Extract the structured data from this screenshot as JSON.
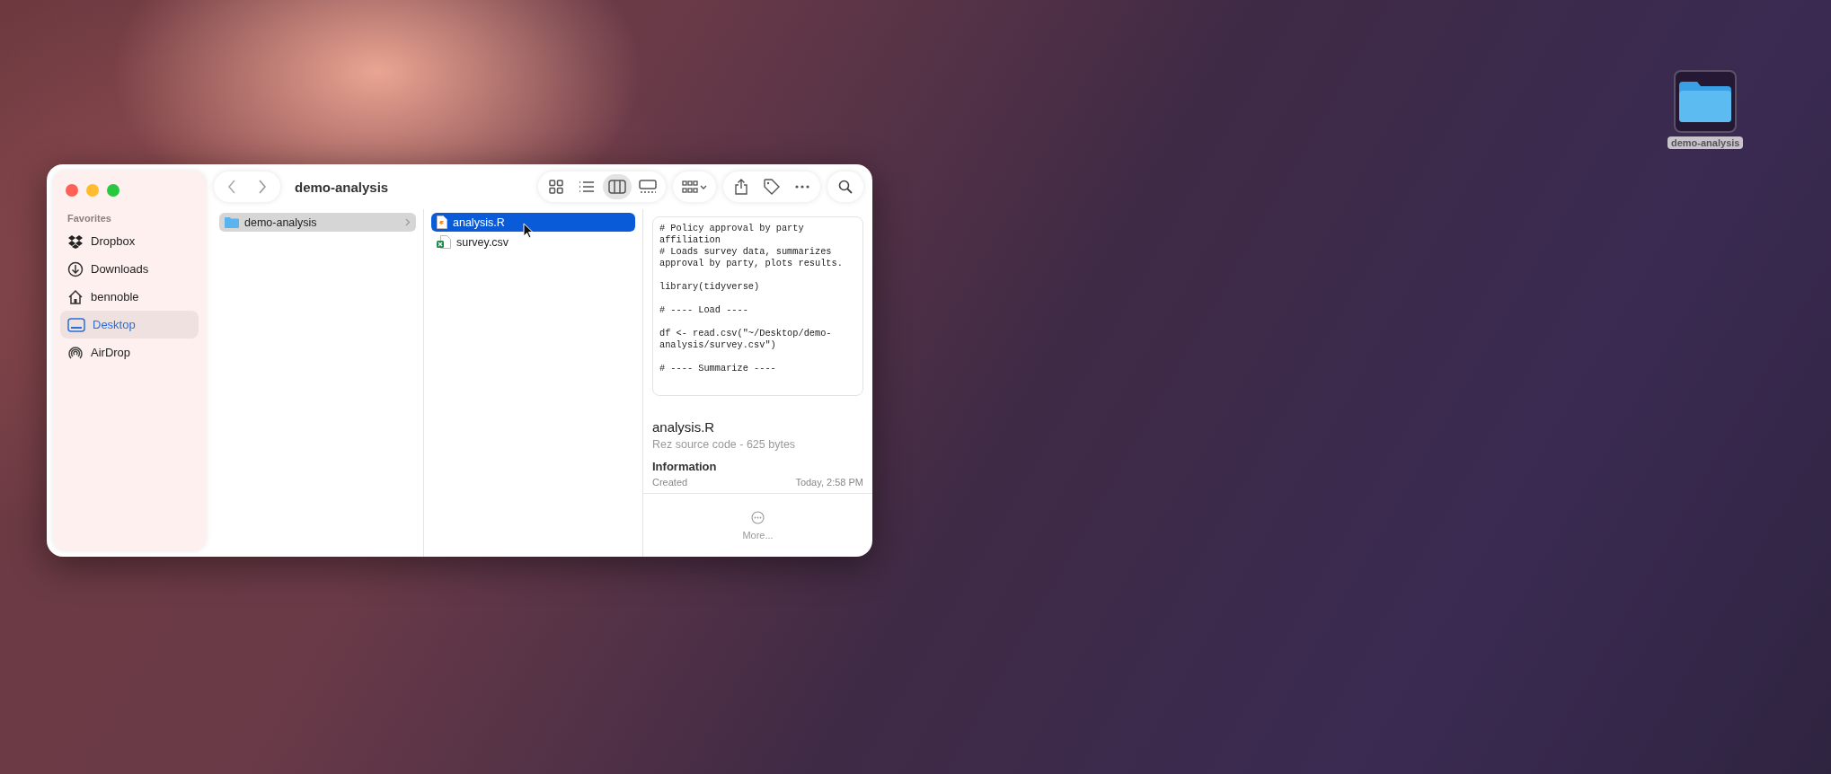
{
  "window": {
    "title": "demo-analysis"
  },
  "sidebar": {
    "heading": "Favorites",
    "items": [
      {
        "label": "Dropbox",
        "selected": false
      },
      {
        "label": "Downloads",
        "selected": false
      },
      {
        "label": "bennoble",
        "selected": false
      },
      {
        "label": "Desktop",
        "selected": true
      },
      {
        "label": "AirDrop",
        "selected": false
      }
    ]
  },
  "view_modes": [
    {
      "selected": false
    },
    {
      "selected": false
    },
    {
      "selected": true
    },
    {
      "selected": false
    }
  ],
  "columns": [
    {
      "focused": false,
      "items": [
        {
          "name": "demo-analysis",
          "kind": "folder",
          "selected": true
        }
      ]
    },
    {
      "focused": true,
      "items": [
        {
          "name": "analysis.R",
          "kind": "script",
          "selected": true
        },
        {
          "name": "survey.csv",
          "kind": "sheet",
          "selected": false
        }
      ]
    }
  ],
  "preview": {
    "code": "# Policy approval by party affiliation\n# Loads survey data, summarizes approval by party, plots results.\n\nlibrary(tidyverse)\n\n# ---- Load ----\n\ndf <- read.csv(\"~/Desktop/demo-analysis/survey.csv\")\n\n# ---- Summarize ----",
    "name": "analysis.R",
    "description": "Rez source code - 625 bytes",
    "info_heading": "Information",
    "info_rows": [
      {
        "label": "Created",
        "value": "Today, 2:58 PM"
      }
    ],
    "more": "More..."
  },
  "desktop_icons": [
    {
      "label": "demo-analysis",
      "selected": true
    }
  ]
}
